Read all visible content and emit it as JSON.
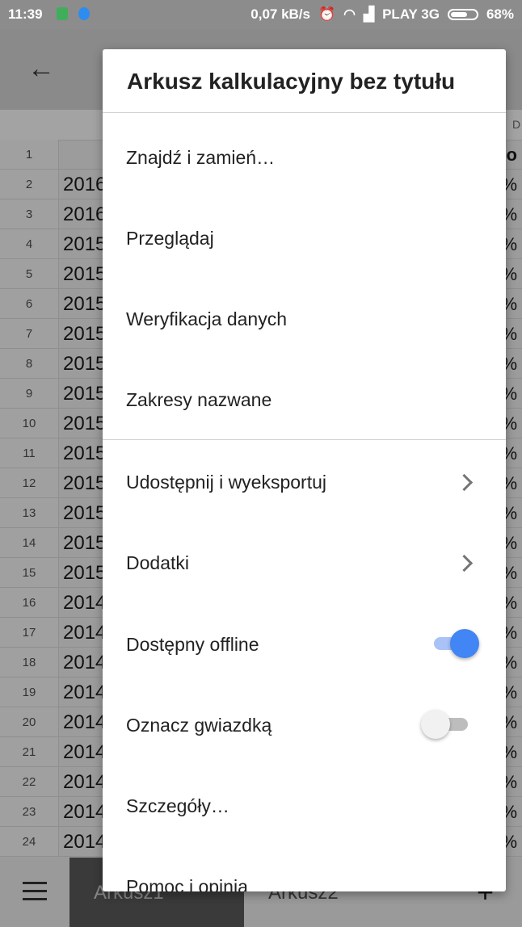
{
  "status_bar": {
    "time": "11:39",
    "net_speed": "0,07 kB/s",
    "carrier": "PLAY 3G",
    "battery": "68%"
  },
  "appbar": {
    "back_icon": "arrow-left-icon"
  },
  "grid": {
    "col_d_label": "D",
    "rows": [
      {
        "n": "1",
        "a": "",
        "r": "lo"
      },
      {
        "n": "2",
        "a": "2016",
        "r": "%"
      },
      {
        "n": "3",
        "a": "2016",
        "r": "%"
      },
      {
        "n": "4",
        "a": "2015",
        "r": "%"
      },
      {
        "n": "5",
        "a": "2015",
        "r": "%"
      },
      {
        "n": "6",
        "a": "2015",
        "r": "%"
      },
      {
        "n": "7",
        "a": "2015",
        "r": "%"
      },
      {
        "n": "8",
        "a": "2015",
        "r": "%"
      },
      {
        "n": "9",
        "a": "2015",
        "r": "%"
      },
      {
        "n": "10",
        "a": "2015",
        "r": "%"
      },
      {
        "n": "11",
        "a": "2015",
        "r": "%"
      },
      {
        "n": "12",
        "a": "2015",
        "r": "%"
      },
      {
        "n": "13",
        "a": "2015",
        "r": "%"
      },
      {
        "n": "14",
        "a": "2015",
        "r": "%"
      },
      {
        "n": "15",
        "a": "2015",
        "r": "%"
      },
      {
        "n": "16",
        "a": "2014",
        "r": "%"
      },
      {
        "n": "17",
        "a": "2014",
        "r": "%"
      },
      {
        "n": "18",
        "a": "2014",
        "r": "%"
      },
      {
        "n": "19",
        "a": "2014",
        "r": "%"
      },
      {
        "n": "20",
        "a": "2014",
        "r": "%"
      },
      {
        "n": "21",
        "a": "2014",
        "r": "%"
      },
      {
        "n": "22",
        "a": "2014",
        "r": "%"
      },
      {
        "n": "23",
        "a": "2014",
        "r": "%"
      },
      {
        "n": "24",
        "a": "2014",
        "r": "%"
      }
    ]
  },
  "bottom": {
    "tab1": "Arkusz1",
    "tab2": "Arkusz2",
    "add": "+"
  },
  "menu": {
    "title": "Arkusz kalkulacyjny bez tytułu",
    "items": [
      {
        "label": "Znajdź i zamień…"
      },
      {
        "label": "Przeglądaj"
      },
      {
        "label": "Weryfikacja danych"
      },
      {
        "label": "Zakresy nazwane"
      },
      {
        "label": "Udostępnij i wyeksportuj"
      },
      {
        "label": "Dodatki"
      },
      {
        "label": "Dostępny offline",
        "toggle": true
      },
      {
        "label": "Oznacz gwiazdką",
        "toggle": false
      },
      {
        "label": "Szczegóły…"
      },
      {
        "label": "Pomoc i opinia"
      }
    ]
  },
  "colors": {
    "accent": "#4285f4",
    "scrim": "#9e9e9e"
  }
}
